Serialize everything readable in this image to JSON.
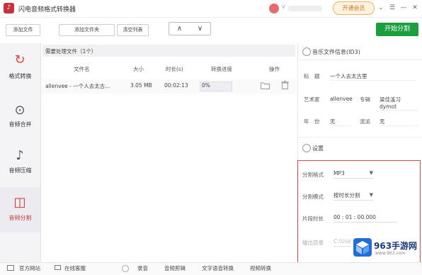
{
  "app": {
    "title": "闪电音频格式转换器",
    "logo_glyph": "♪"
  },
  "titlebar": {
    "vip_icon": "V",
    "vip_button": "开通会员",
    "btn_user": "⌄",
    "btn_menu": "☰",
    "btn_min": "—",
    "btn_close": "✕"
  },
  "toolbar": {
    "add_file": "添加文件",
    "add_folder": "添加文件夹",
    "clear_list": "清空列表",
    "up": "∧",
    "down": "∨",
    "start": "开始分割"
  },
  "sidebar": {
    "items": [
      {
        "label": "格式转换",
        "icon": "↻"
      },
      {
        "label": "音频合并",
        "icon": "⊙"
      },
      {
        "label": "音频压缩",
        "icon": "♪"
      },
      {
        "label": "音频分割",
        "icon": "◫"
      }
    ]
  },
  "filelist": {
    "title": "需要处理文件（1个）",
    "columns": [
      "文件名",
      "大小",
      "时长(s)",
      "转换进度",
      "操作"
    ],
    "rows": [
      {
        "name": "allenvee - 一个人去太古...",
        "size": "3.05 MB",
        "duration": "00:02:13",
        "progress": "0%"
      }
    ]
  },
  "info": {
    "title": "音乐文件信息(ID3)",
    "title_label": "标　题",
    "title_value": "一个人去太古里",
    "artist_label": "艺术家",
    "artist_value": "allenvee",
    "album_label": "专辑",
    "album_value": "梁佳溪习dymot",
    "year_label": "年　份",
    "year_value": "无",
    "genre_label": "流派",
    "genre_value": "无"
  },
  "settings": {
    "title": "设置",
    "format_label": "分割格式",
    "format_value": "MP3",
    "mode_label": "分割模式",
    "mode_value": "按时长分割",
    "segment_label": "片段时长",
    "segment_value": "00 : 01 : 00.000",
    "output_label": "输出目录",
    "output_value": "C:\\Users\\...\\Desktop"
  },
  "bottom": {
    "items": [
      "官方网站",
      "在线客服",
      "录音",
      "音频剪辑",
      "文字语音转换",
      "视频转换"
    ]
  },
  "watermark": {
    "main": "963手游网",
    "sub": "www.963.com"
  }
}
